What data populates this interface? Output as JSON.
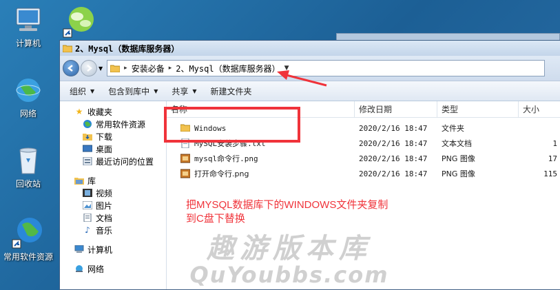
{
  "desktop": {
    "icons": [
      {
        "label": "计算机"
      },
      {
        "label": ""
      },
      {
        "label": "网络"
      },
      {
        "label": "回收站"
      },
      {
        "label": "常用软件资源"
      }
    ]
  },
  "window": {
    "title": "2、Mysql（数据库服务器）",
    "breadcrumb": [
      "安装必备",
      "2、Mysql（数据库服务器）"
    ]
  },
  "toolbar": {
    "organize": "组织",
    "include_library": "包含到库中",
    "share": "共享",
    "new_folder": "新建文件夹"
  },
  "nav_pane": {
    "favorites": "收藏夹",
    "favorites_items": [
      "常用软件资源",
      "下载",
      "桌面",
      "最近访问的位置"
    ],
    "libraries": "库",
    "library_items": [
      "视频",
      "图片",
      "文档",
      "音乐"
    ],
    "computer": "计算机",
    "network": "网络"
  },
  "columns": {
    "name": "名称",
    "date": "修改日期",
    "type": "类型",
    "size": "大小"
  },
  "files": [
    {
      "name": "Windows",
      "date": "2020/2/16 18:47",
      "type": "文件夹",
      "size": "",
      "kind": "folder"
    },
    {
      "name": "MySQL安装步骤.txt",
      "date": "2020/2/16 18:47",
      "type": "文本文档",
      "size": "1",
      "kind": "txt"
    },
    {
      "name": "mysql命令行.png",
      "date": "2020/2/16 18:47",
      "type": "PNG 图像",
      "size": "17",
      "kind": "png"
    },
    {
      "name": "打开命令行.png",
      "date": "2020/2/16 18:47",
      "type": "PNG 图像",
      "size": "115",
      "kind": "png"
    }
  ],
  "annotation": {
    "line1": "把MYSQL数据库下的WINDOWS文件夹复制",
    "line2": "到C盘下替换"
  },
  "watermark": {
    "main": "趣游版本库",
    "sub": "QuYoubbs.com"
  },
  "colors": {
    "annotation": "#f0333a",
    "desktop_bg": "#1c5f95"
  }
}
